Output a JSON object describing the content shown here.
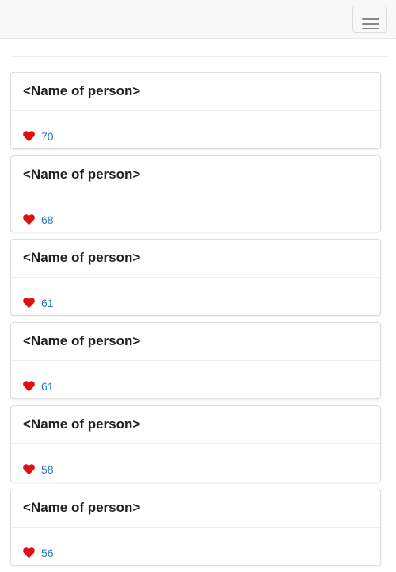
{
  "navbar": {
    "toggle_icon": "hamburger-menu-icon"
  },
  "colors": {
    "heart": "#e01010",
    "count": "#2a7ab9",
    "title": "#222222"
  },
  "people": [
    {
      "name": "<Name of person>",
      "likes": "70"
    },
    {
      "name": "<Name of person>",
      "likes": "68"
    },
    {
      "name": "<Name of person>",
      "likes": "61"
    },
    {
      "name": "<Name of person>",
      "likes": "61"
    },
    {
      "name": "<Name of person>",
      "likes": "58"
    },
    {
      "name": "<Name of person>",
      "likes": "56"
    }
  ]
}
